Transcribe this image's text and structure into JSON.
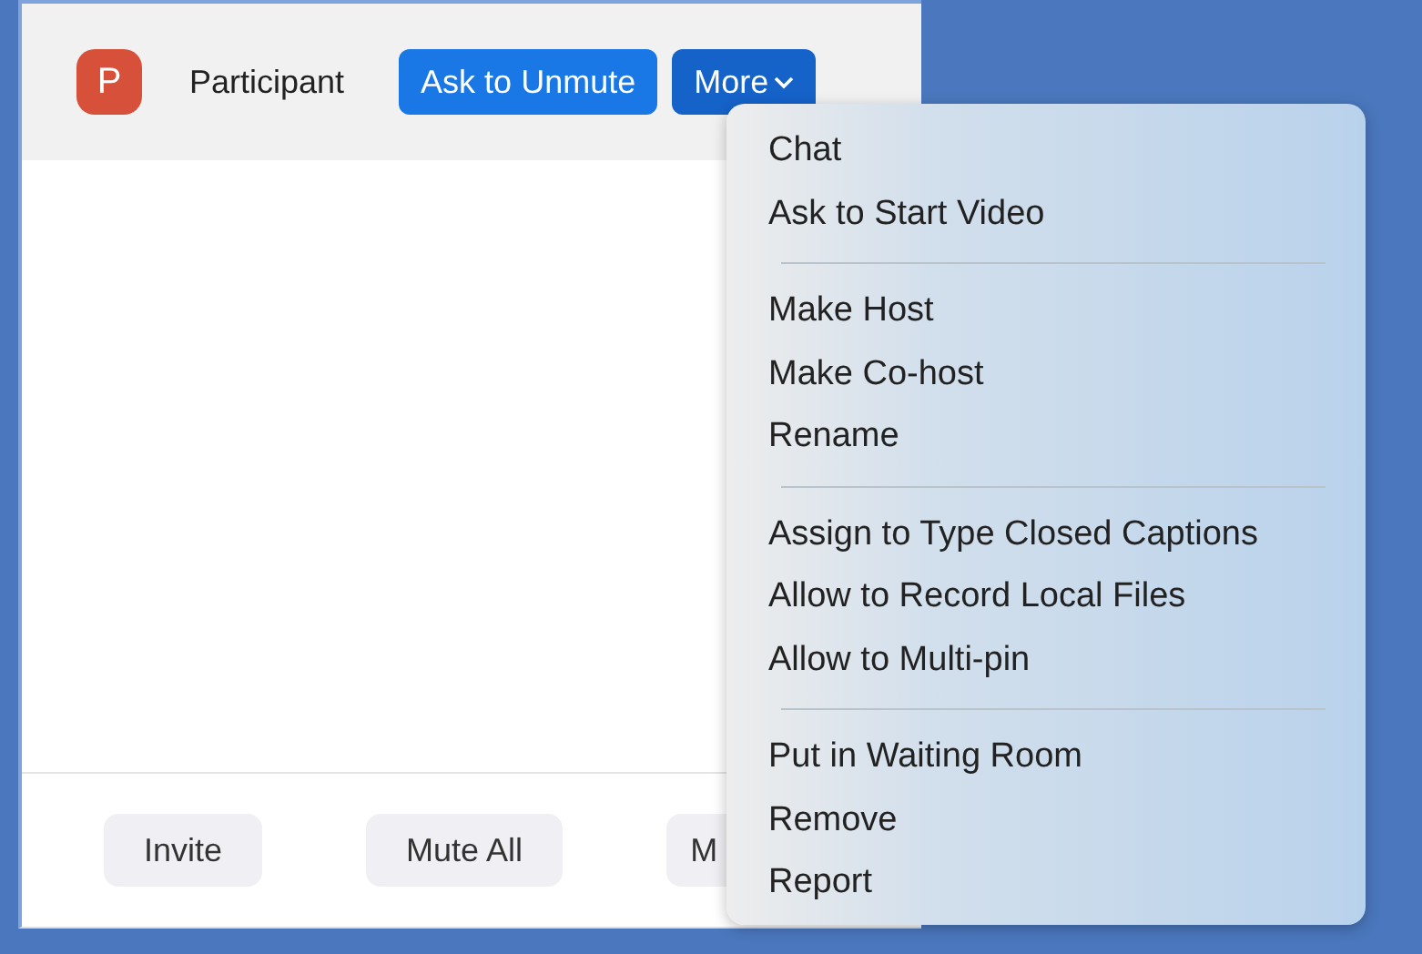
{
  "participant": {
    "avatar_letter": "P",
    "name": "Participant"
  },
  "row_buttons": [
    {
      "label": "Ask to Unmute",
      "kind": "primary"
    },
    {
      "label": "More",
      "kind": "dropdown"
    }
  ],
  "menu": {
    "groups": [
      {
        "items": [
          "Chat",
          "Ask to Start Video"
        ]
      },
      {
        "items": [
          "Make Host",
          "Make Co-host",
          "Rename"
        ]
      },
      {
        "items": [
          "Assign to Type Closed Captions",
          "Allow to Record Local Files",
          "Allow to Multi-pin"
        ]
      },
      {
        "items": [
          "Put in Waiting Room",
          "Remove",
          "Report"
        ]
      }
    ]
  },
  "footer_buttons": [
    "Invite",
    "Mute All",
    "M"
  ]
}
